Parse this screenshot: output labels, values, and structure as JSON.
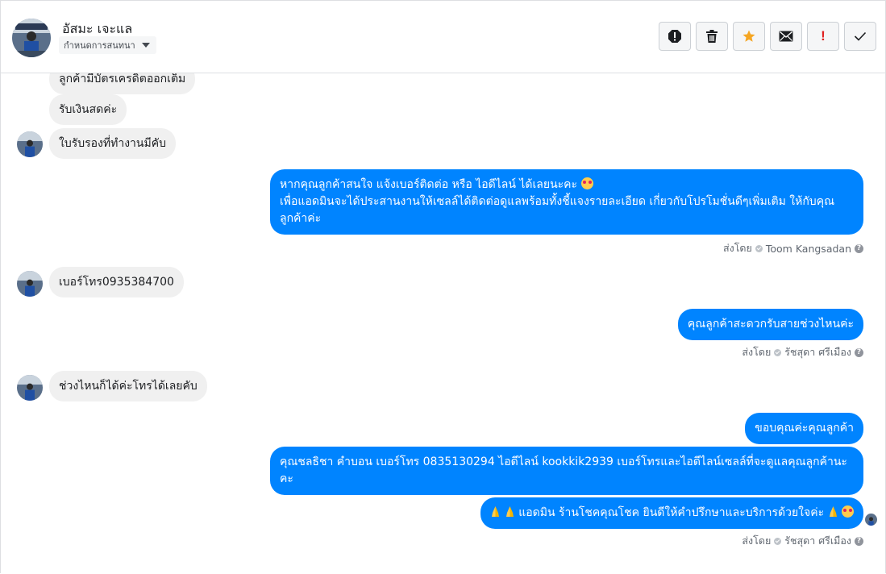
{
  "header": {
    "contact_name": "อัสมะ เจะแล",
    "assign_label": "กำหนดการสนทนา",
    "actions": [
      {
        "name": "report-icon"
      },
      {
        "name": "trash-icon"
      },
      {
        "name": "star-icon"
      },
      {
        "name": "mail-icon"
      },
      {
        "name": "important-icon"
      },
      {
        "name": "checkmark-icon"
      }
    ]
  },
  "messages": {
    "m0": "ลูกค้ามีบัตรเครดิตออกเต็ม",
    "m1": "รับเงินสดค่ะ",
    "m2": "ใบรับรองที่ทำงานมีคับ",
    "m3_line1": "หากคุณลูกค้าสนใจ แจ้งเบอร์ติดต่อ หรือ ไอดีไลน์ ได้เลยนะคะ",
    "m3_line2": "เพื่อแอดมินจะได้ประสานงานให้เซลล์ได้ติดต่อดูแลพร้อมทั้งชี้แจงรายละเอียด เกี่ยวกับโปรโมชั่นดีๆเพิ่มเติม ให้กับคุณลูกค้าค่ะ",
    "m4": "เบอร์โทร0935384700",
    "m5": "คุณลูกค้าสะดวกรับสายช่วงไหนค่ะ",
    "m6": "ช่วงไหนก็ได้ค่ะโทรได้เลยคับ",
    "m7": "ขอบคุณค่ะคุณลูกค้า",
    "m8": "คุณชลธิชา คำบอน เบอร์โทร 0835130294  ไอดีไลน์ kookkik2939   เบอร์โทรและไอดีไลน์เซลล์ที่จะดูแลคุณลูกค้านะคะ",
    "m9": "แอดมิน ร้านโชคคุณโชค ยินดีให้คำปรึกษาและบริการด้วยใจค่ะ"
  },
  "sent_by": {
    "prefix": "ส่งโดย",
    "agent1": "Toom Kangsadan",
    "agent2": "รัชสุดา ศรีเมือง",
    "agent3": "รัชสุดา ศรีเมือง",
    "help": "?"
  },
  "colors": {
    "outgoing_bubble": "#0084ff",
    "incoming_bubble": "#f0f0f0",
    "star": "#f5a623",
    "important": "#e02020"
  }
}
